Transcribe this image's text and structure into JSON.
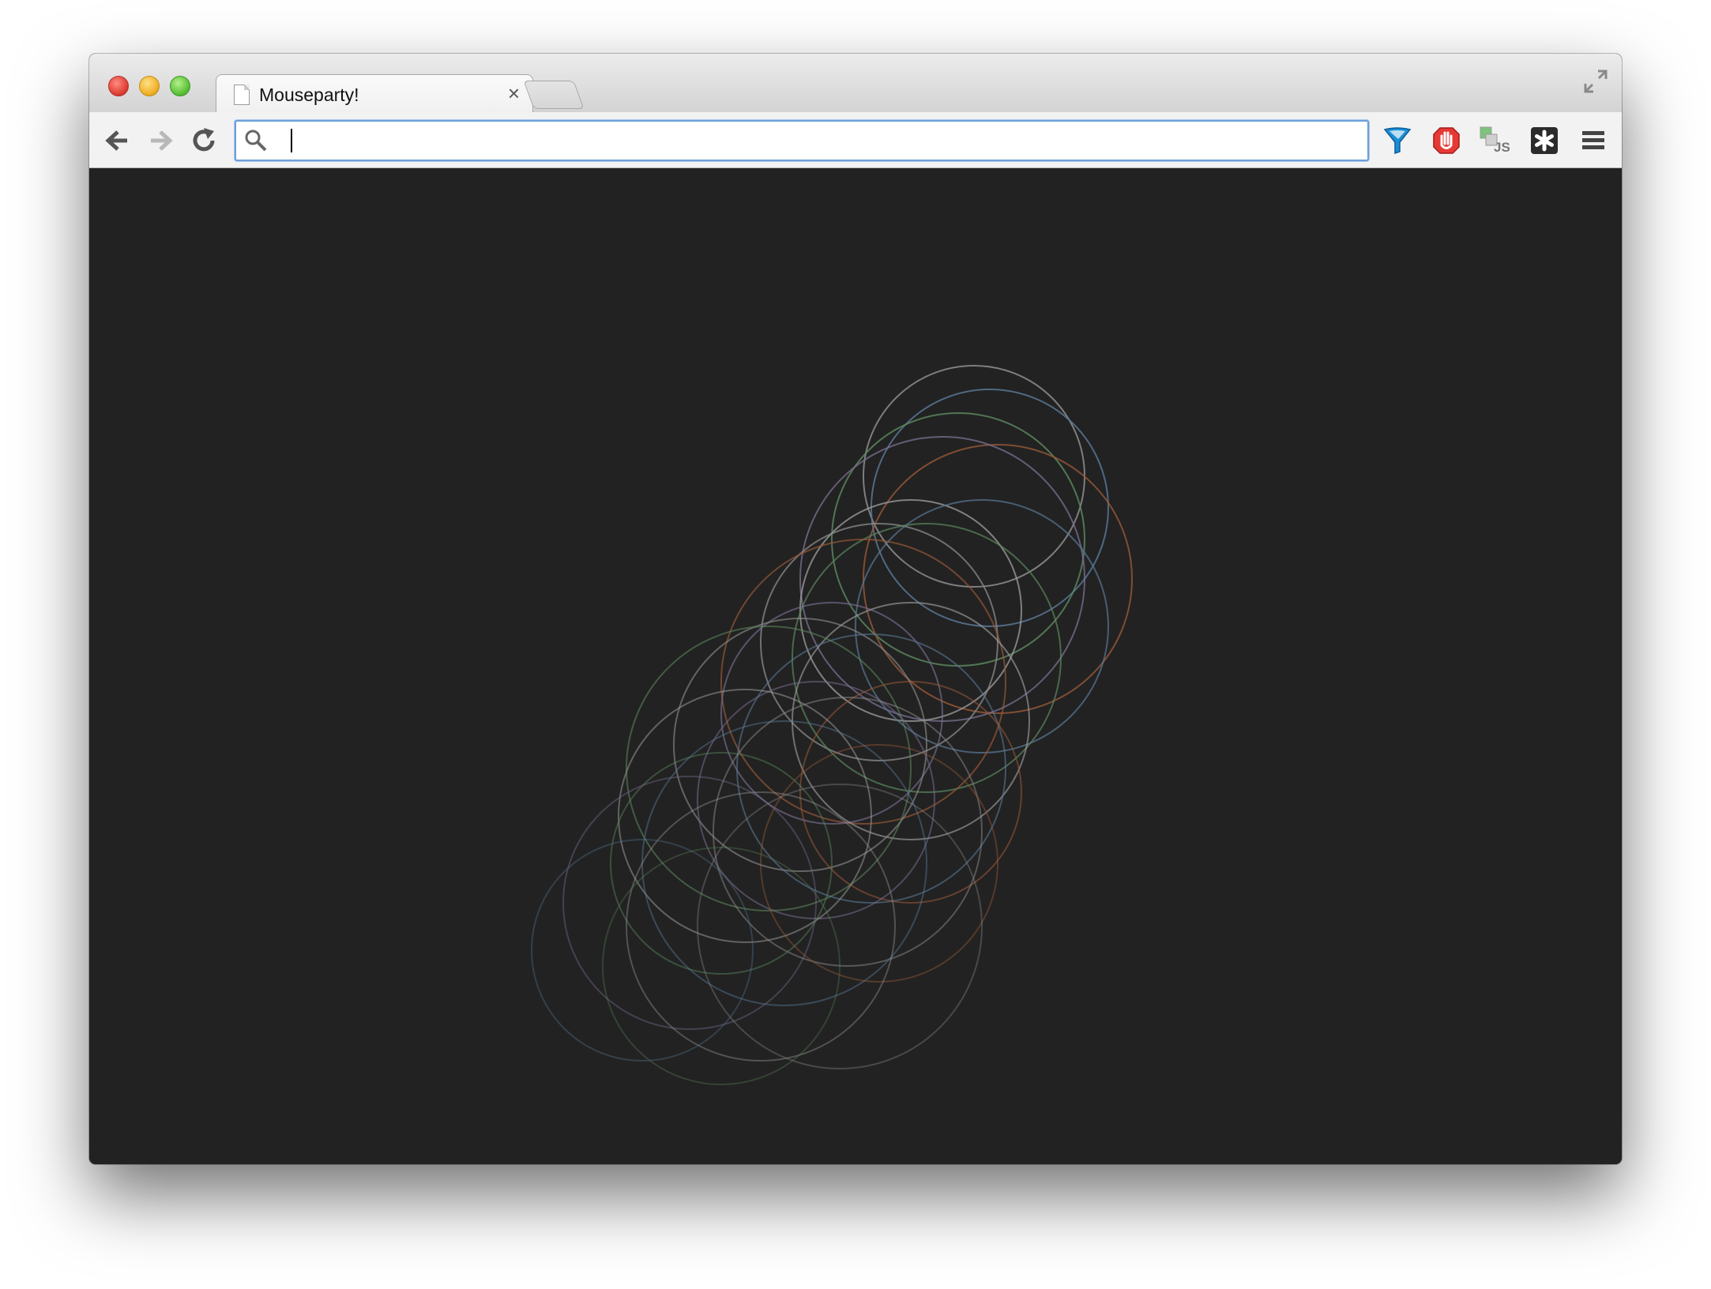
{
  "tab": {
    "title": "Mouseparty!"
  },
  "omnibox": {
    "value": "",
    "placeholder": ""
  },
  "toolbar": {
    "extensions": [
      "filter-icon",
      "stop-hand-icon",
      "js-icon",
      "asterisk-icon",
      "menu-icon"
    ]
  },
  "page": {
    "background": "#222222",
    "ring_colors": [
      "#8e8e8e",
      "#5a7896",
      "#5d8a5f",
      "#9a5a38",
      "#7a6e92",
      "#a0a0a0"
    ]
  }
}
